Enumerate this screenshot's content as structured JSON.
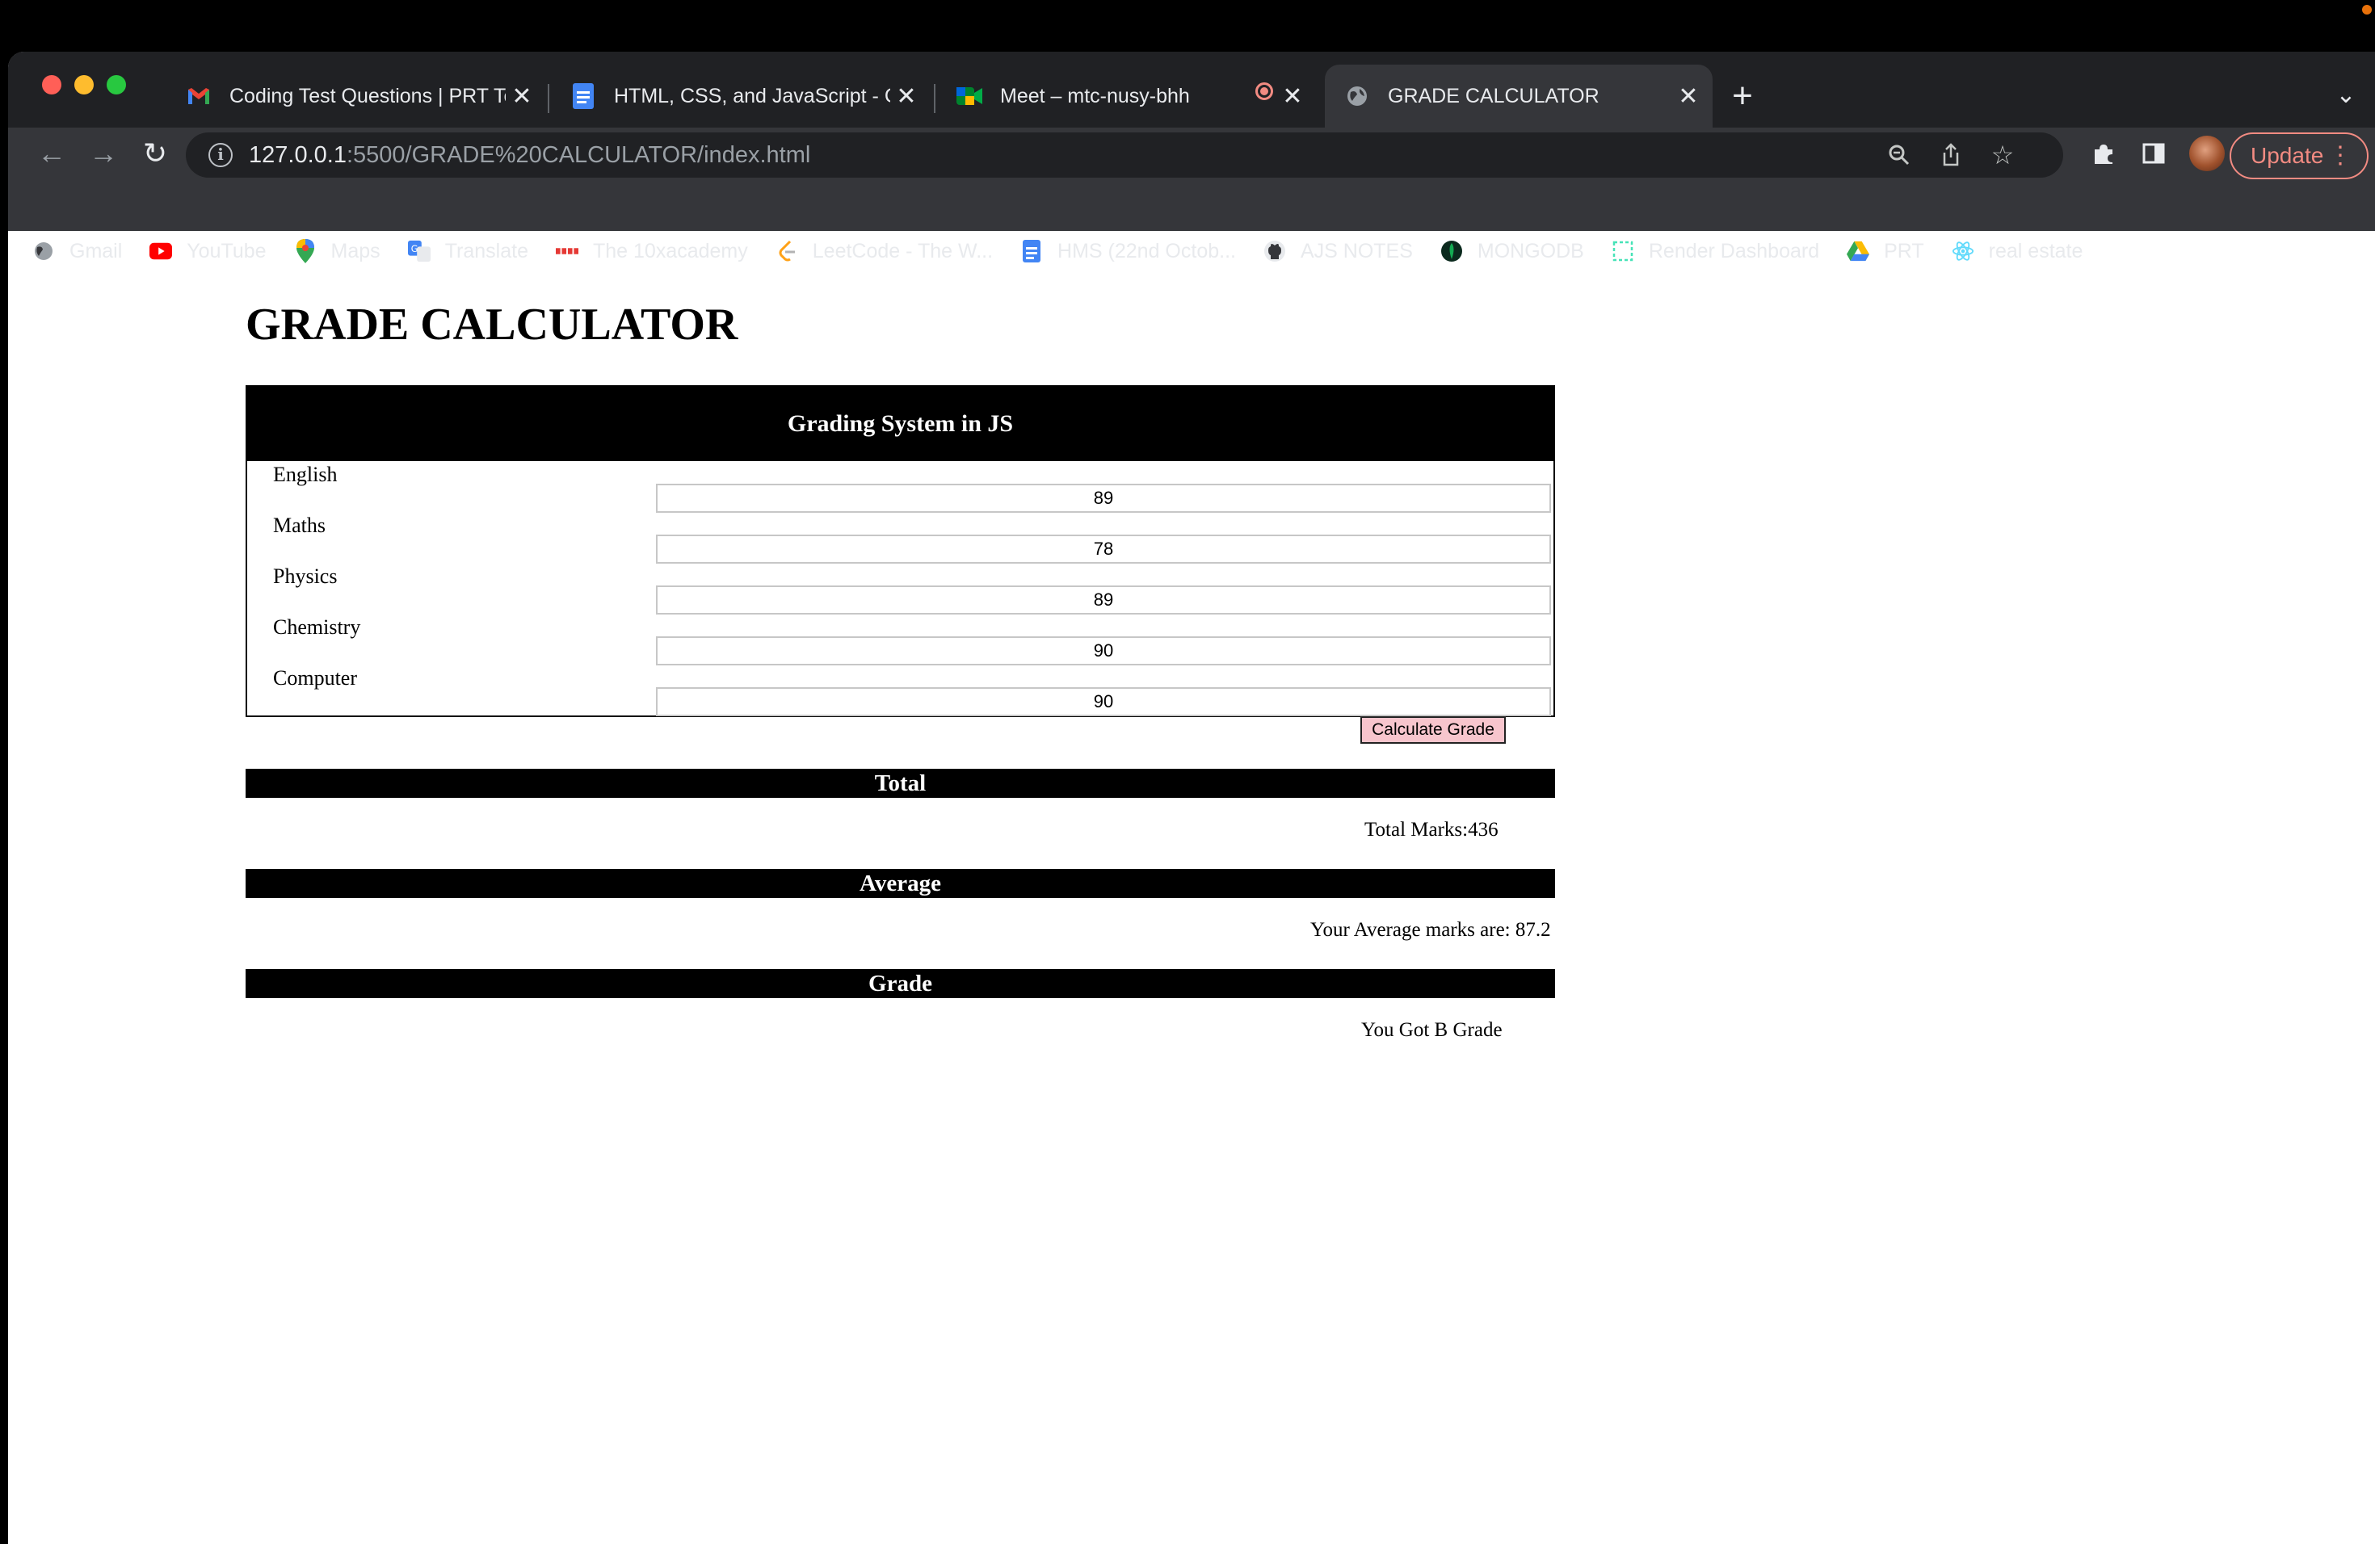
{
  "browser": {
    "tabs": [
      {
        "title": "Coding Test Questions | PRT Te",
        "favicon": "gmail-icon"
      },
      {
        "title": "HTML, CSS, and JavaScript - C",
        "favicon": "docs-icon"
      },
      {
        "title": "Meet – mtc-nusy-bhh",
        "favicon": "meet-icon"
      },
      {
        "title": "GRADE CALCULATOR",
        "favicon": "globe-icon"
      }
    ],
    "address": {
      "host": "127.0.0.1",
      "rest": ":5500/GRADE%20CALCULATOR/index.html"
    },
    "update_label": "Update",
    "bookmarks": [
      {
        "label": "Gmail",
        "icon": "globe-icon"
      },
      {
        "label": "YouTube",
        "icon": "youtube-icon"
      },
      {
        "label": "Maps",
        "icon": "maps-icon"
      },
      {
        "label": "Translate",
        "icon": "translate-icon"
      },
      {
        "label": "The 10xacademy",
        "icon": "10x-icon"
      },
      {
        "label": "LeetCode - The W...",
        "icon": "leetcode-icon"
      },
      {
        "label": "HMS (22nd Octob...",
        "icon": "docs-icon"
      },
      {
        "label": "AJS NOTES",
        "icon": "github-icon"
      },
      {
        "label": "MONGODB",
        "icon": "mongodb-icon"
      },
      {
        "label": "Render Dashboard",
        "icon": "render-icon"
      },
      {
        "label": "PRT",
        "icon": "drive-icon"
      },
      {
        "label": "real estate",
        "icon": "react-icon"
      }
    ]
  },
  "page": {
    "title": "GRADE CALCULATOR",
    "table_heading": "Grading System in JS",
    "subjects": [
      {
        "label": "English",
        "value": "89"
      },
      {
        "label": "Maths",
        "value": "78"
      },
      {
        "label": "Physics",
        "value": "89"
      },
      {
        "label": "Chemistry",
        "value": "90"
      },
      {
        "label": "Computer",
        "value": "90"
      }
    ],
    "calc_button": "Calculate Grade",
    "total": {
      "heading": "Total",
      "text": "Total Marks:436"
    },
    "average": {
      "heading": "Average",
      "text": "Your Average marks are: 87.2"
    },
    "grade": {
      "heading": "Grade",
      "text": "You Got B Grade"
    }
  },
  "colors": {
    "tabstrip": "#202124",
    "toolbar": "#35363a",
    "calc_button_bg": "#f7c5cd",
    "section_bar": "#000000"
  }
}
